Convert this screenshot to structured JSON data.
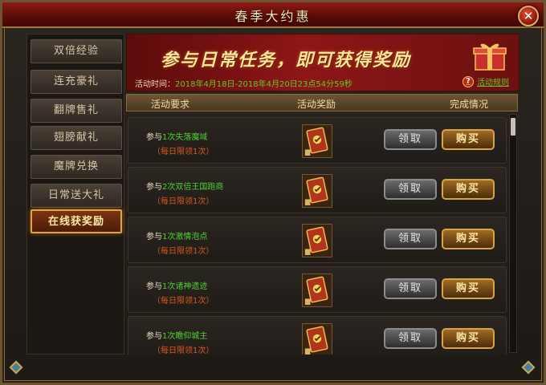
{
  "window": {
    "title": "春季大约惠"
  },
  "sidebar": {
    "items": [
      {
        "label": "双倍经验"
      },
      {
        "label": "连充豪礼"
      },
      {
        "label": "翻牌售礼"
      },
      {
        "label": "翅膀献礼"
      },
      {
        "label": "魔牌兑换"
      },
      {
        "label": "日常送大礼"
      },
      {
        "label": "在线获奖励"
      }
    ],
    "active_index": 6
  },
  "banner": {
    "headline": "参与日常任务，即可获得奖励",
    "time_label": "活动时间：",
    "time_value": "2018年4月18日-2018年4月20日23点54分59秒",
    "help_label": "活动规则",
    "help_icon": "?"
  },
  "columns": {
    "requirement": "活动要求",
    "reward": "活动奖励",
    "status": "完成情况"
  },
  "rows": [
    {
      "prefix": "参与",
      "task": "1次失落魔域",
      "limit": "（每日限领1次）",
      "claim": "领取",
      "buy": "购买"
    },
    {
      "prefix": "参与",
      "task": "2次双倍王国跑商",
      "limit": "（每日限领1次）",
      "claim": "领取",
      "buy": "购买"
    },
    {
      "prefix": "参与",
      "task": "1次激情泡点",
      "limit": "（每日限领1次）",
      "claim": "领取",
      "buy": "购买"
    },
    {
      "prefix": "参与",
      "task": "1次诸神遗迹",
      "limit": "（每日限领1次）",
      "claim": "领取",
      "buy": "购买"
    },
    {
      "prefix": "参与",
      "task": "1次瞻仰城主",
      "limit": "（每日限领1次）",
      "claim": "领取",
      "buy": "购买"
    }
  ],
  "close_icon": "✕",
  "colors": {
    "accent_red": "#8e1a13",
    "gold": "#d7a446",
    "task_green": "#4fd131",
    "limit_orange": "#d75b1e"
  }
}
